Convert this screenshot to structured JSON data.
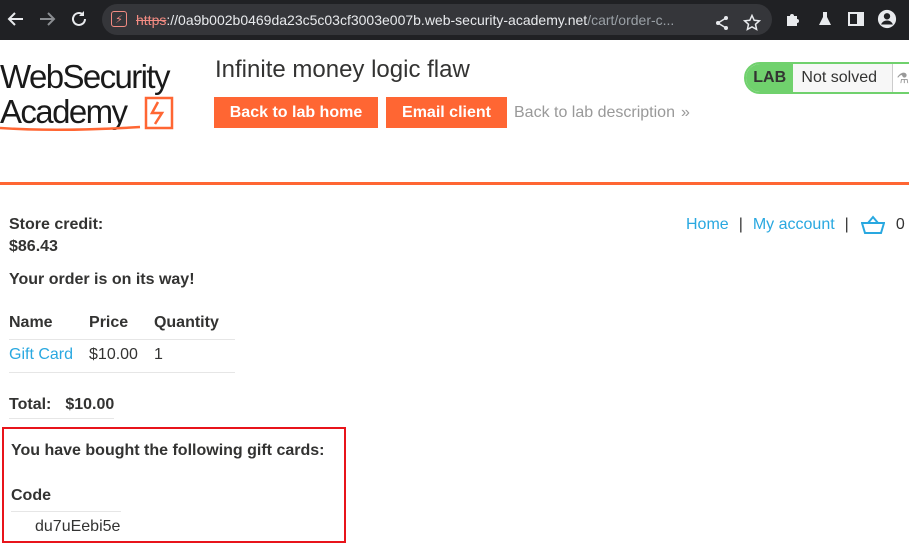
{
  "browser": {
    "url_scheme": "https",
    "url_host": "://0a9b002b0469da23c5c03cf3003e007b.web-security-academy.net",
    "url_path": "/cart/order-c..."
  },
  "header": {
    "logo_line1": "WebSecurity",
    "logo_line2": "Academy",
    "lab_title": "Infinite money logic flaw",
    "back_to_lab_home": "Back to lab home",
    "email_client": "Email client",
    "back_to_description": "Back to lab description",
    "status_lab": "LAB",
    "status_state": "Not solved"
  },
  "nav": {
    "home": "Home",
    "sep": "|",
    "my_account": "My account",
    "cart_count": "0"
  },
  "store": {
    "credit_label": "Store credit:",
    "credit_value": "$86.43",
    "order_message": "Your order is on its way!"
  },
  "order_table": {
    "headers": [
      "Name",
      "Price",
      "Quantity"
    ],
    "rows": [
      {
        "name": "Gift Card",
        "price": "$10.00",
        "quantity": "1"
      }
    ]
  },
  "total": {
    "label": "Total:",
    "value": "$10.00"
  },
  "gift_cards": {
    "heading": "You have bought the following gift cards:",
    "code_header": "Code",
    "codes": [
      "du7uEebi5e"
    ]
  },
  "colors": {
    "brand_orange": "#ff6633",
    "link_blue": "#29a8e0",
    "status_green": "#70d16d",
    "highlight_red": "#e8141b"
  }
}
